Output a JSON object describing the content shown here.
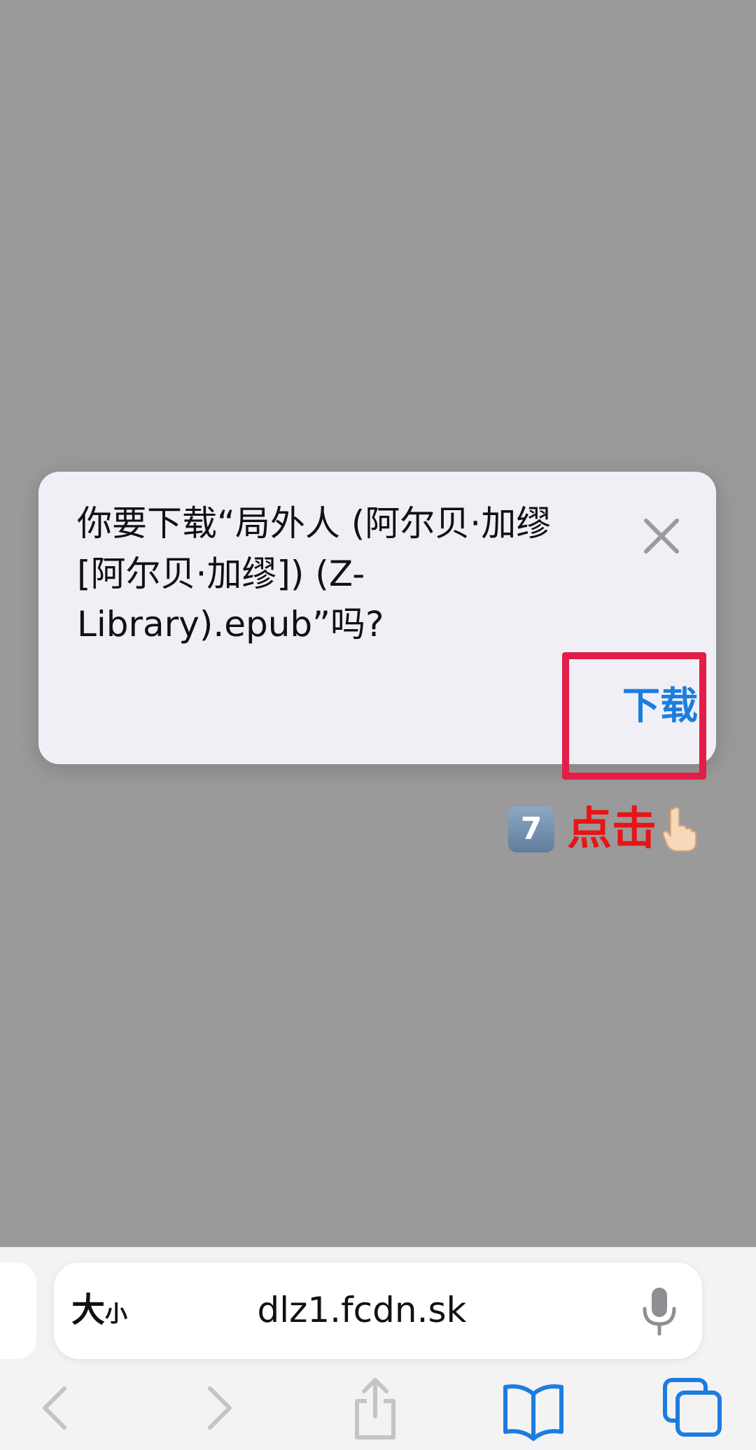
{
  "dialog": {
    "message": "你要下载“局外人 (阿尔贝·加缪 [阿尔贝·加缪]) (Z-Library).epub”吗?",
    "download_label": "下载",
    "close_icon": "close-icon"
  },
  "annotation": {
    "step_number": "7",
    "text": "点击",
    "icon": "pointing-hand-icon"
  },
  "address_bar": {
    "text_size_big": "大",
    "text_size_small": "小",
    "url": "dlz1.fcdn.sk",
    "mic_icon": "microphone-icon"
  },
  "toolbar": {
    "items": [
      "back-icon",
      "forward-icon",
      "share-icon",
      "bookmarks-icon",
      "tabs-icon"
    ]
  },
  "colors": {
    "accent": "#1c7de0",
    "highlight": "#e11d48",
    "annotation_text": "#e81416",
    "overlay": "#9a9a9a"
  }
}
